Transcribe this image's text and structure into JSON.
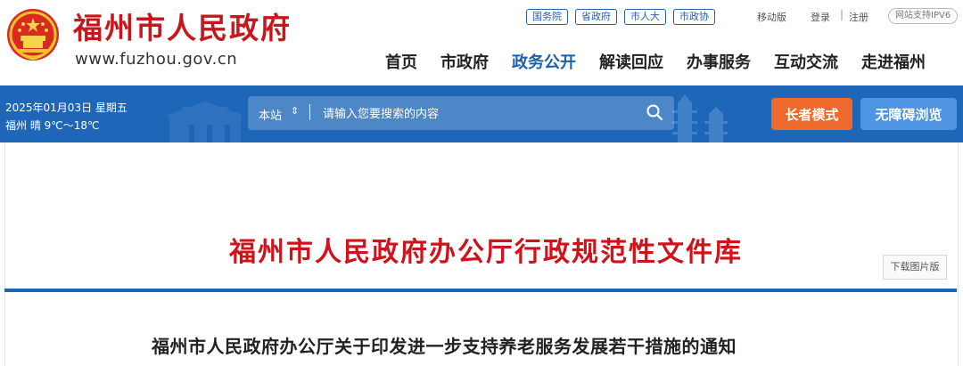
{
  "header": {
    "site_name": "福州市人民政府",
    "site_url": "www.fuzhou.gov.cn",
    "top_links": [
      "国务院",
      "省政府",
      "市人大",
      "市政协"
    ],
    "mobile": "移动版",
    "login": "登录",
    "separator": "|",
    "register": "注册",
    "ipv6": "网站支持IPV6",
    "nav": [
      "首页",
      "市政府",
      "政务公开",
      "解读回应",
      "办事服务",
      "互动交流",
      "走进福州"
    ],
    "nav_active": "政务公开"
  },
  "bar": {
    "date": "2025年01月03日 星期五",
    "weather": "福州 晴 9℃～18℃",
    "scope": "本站",
    "scope_arrow": "⇕",
    "search_placeholder": "请输入您要搜索的内容",
    "elder_mode": "长者模式",
    "accessible": "无障碍浏览"
  },
  "content": {
    "page_title": "福州市人民政府办公厅行政规范性文件库",
    "download": "下载图片版",
    "doc_title": "福州市人民政府办公厅关于印发进一步支持养老服务发展若干措施的通知"
  },
  "colors": {
    "brand_red": "#c8161d",
    "bar_blue": "#1d66b8",
    "elder_orange": "#ee6a2c",
    "access_blue": "#4e94e0",
    "nav_active": "#1f5ea8"
  },
  "icons": {
    "emblem": "national-emblem-icon",
    "search": "search-icon"
  }
}
